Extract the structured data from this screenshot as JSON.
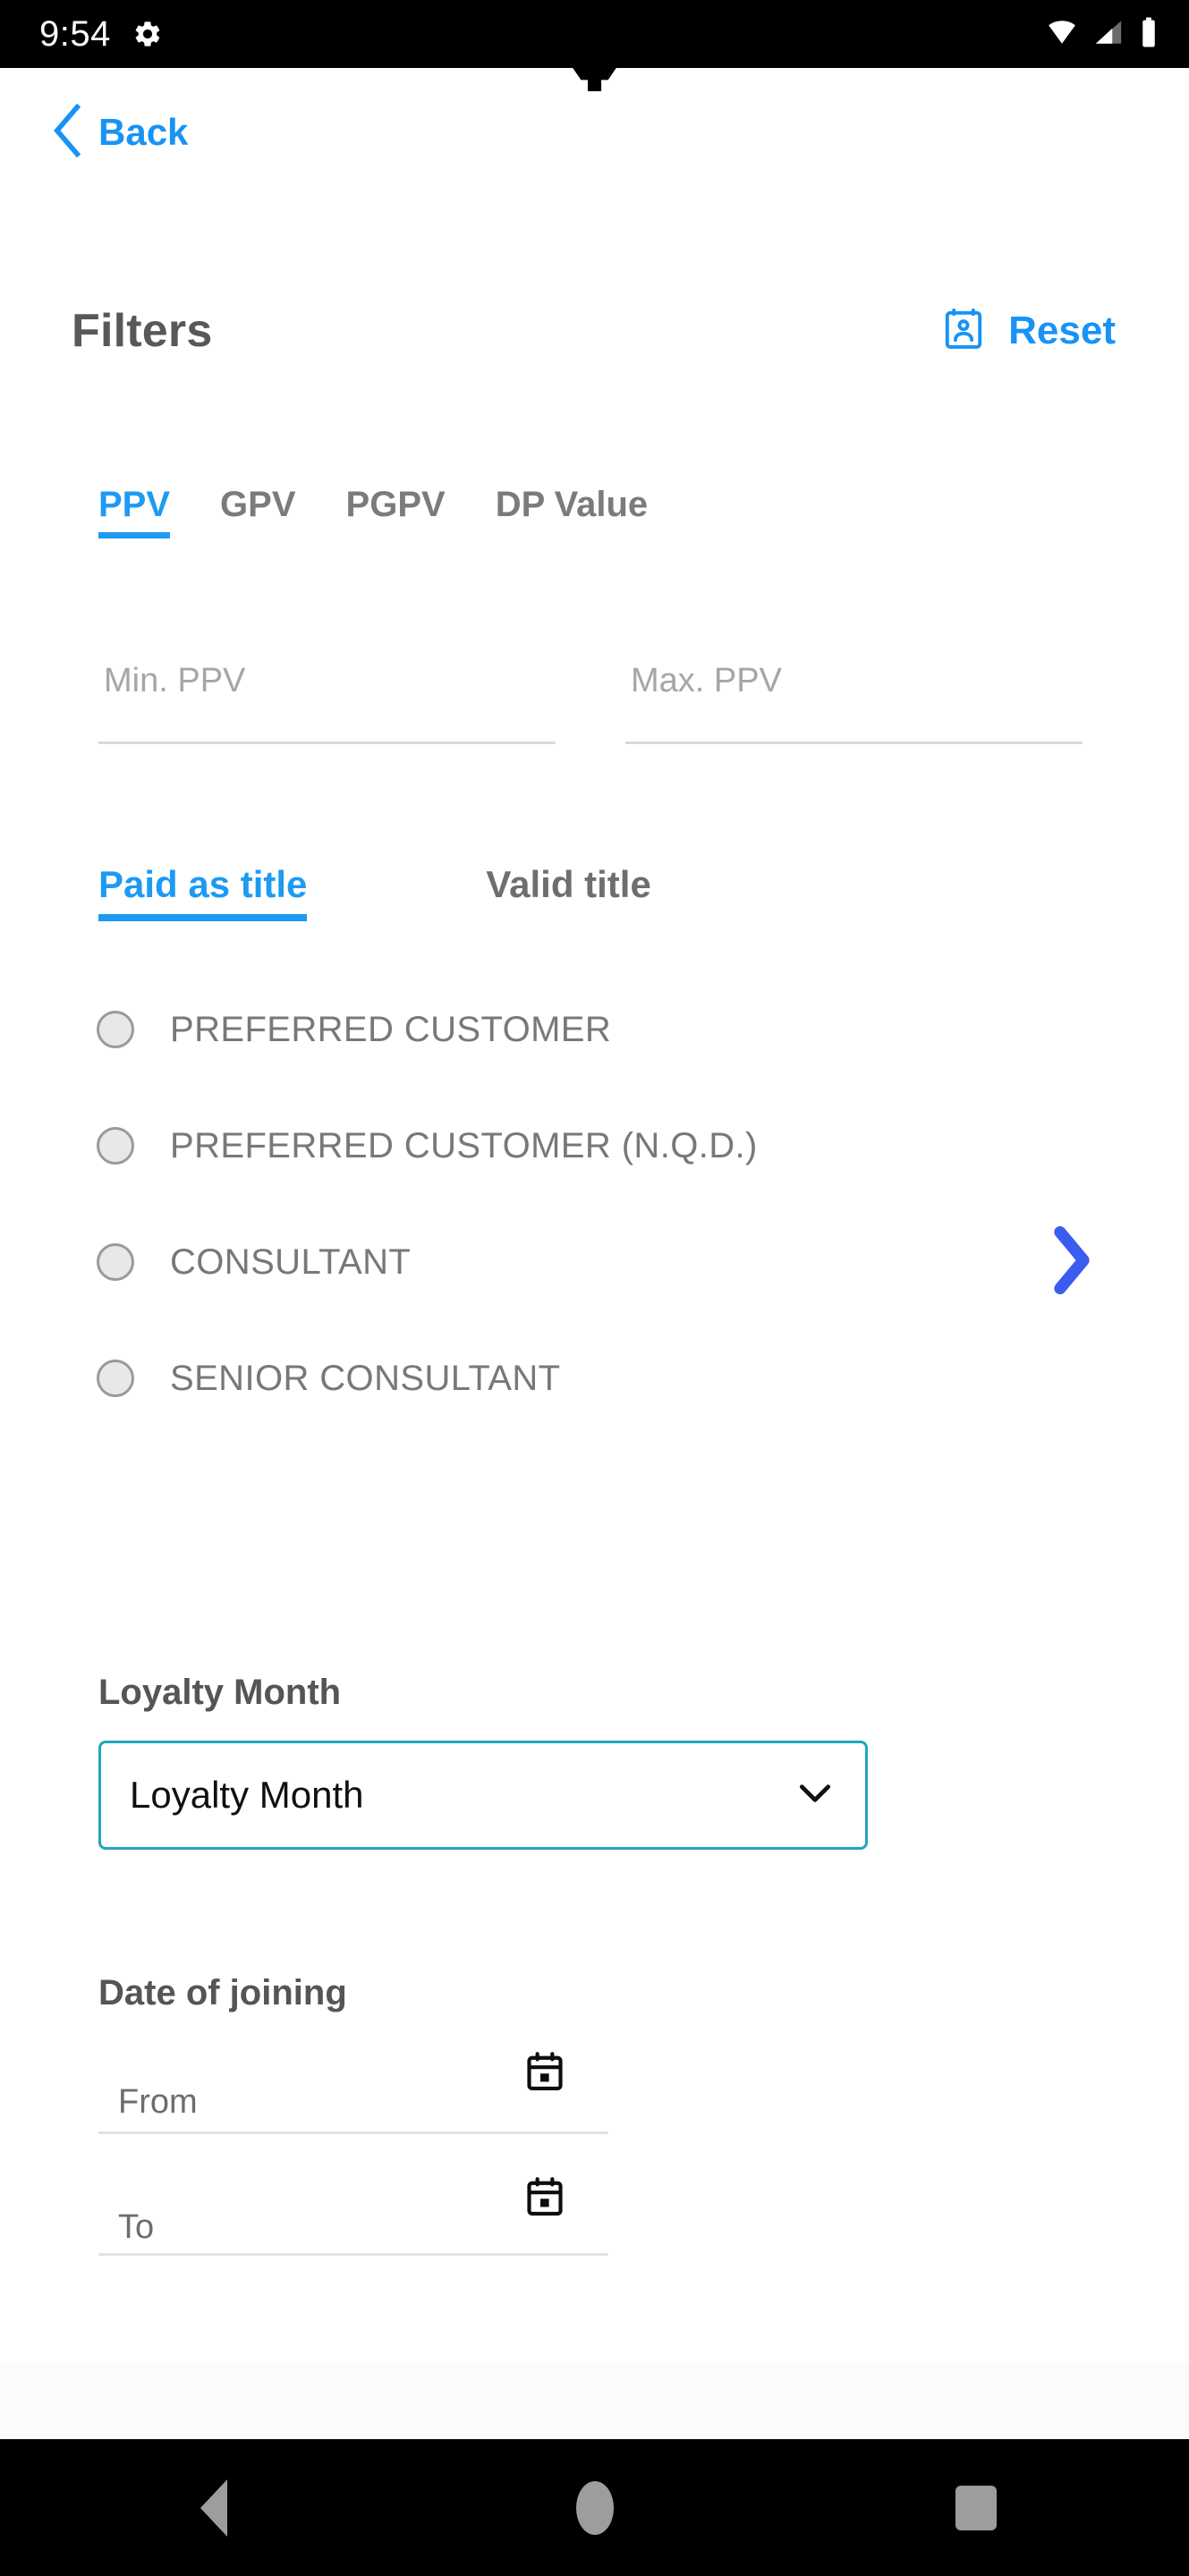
{
  "status_bar": {
    "time": "9:54",
    "icons": [
      "gear-icon",
      "wifi-icon",
      "cellular-signal-icon",
      "battery-icon"
    ]
  },
  "nav": {
    "back_label": "Back",
    "back_icon": "chevron-left-icon"
  },
  "header": {
    "title": "Filters",
    "reset_label": "Reset",
    "reset_icon": "contact-card-icon"
  },
  "value_tabs": {
    "active_index": 0,
    "items": [
      {
        "label": "PPV"
      },
      {
        "label": "GPV"
      },
      {
        "label": "PGPV"
      },
      {
        "label": "DP Value"
      }
    ]
  },
  "range_inputs": {
    "min": {
      "value": "",
      "placeholder": "Min. PPV"
    },
    "max": {
      "value": "",
      "placeholder": "Max. PPV"
    }
  },
  "title_tabs": {
    "active_index": 0,
    "items": [
      {
        "label": "Paid as title"
      },
      {
        "label": "Valid title"
      }
    ]
  },
  "title_options": [
    {
      "label": "PREFERRED CUSTOMER",
      "selected": false
    },
    {
      "label": "PREFERRED CUSTOMER (N.Q.D.)",
      "selected": false
    },
    {
      "label": "CONSULTANT",
      "selected": false
    },
    {
      "label": "SENIOR CONSULTANT",
      "selected": false
    }
  ],
  "next_arrow": {
    "icon": "chevron-right-icon"
  },
  "loyalty": {
    "section_label": "Loyalty Month",
    "select_value": "Loyalty Month",
    "chevron_icon": "chevron-down-icon"
  },
  "date_of_joining": {
    "section_label": "Date of joining",
    "from": {
      "value": "",
      "placeholder": "From",
      "icon": "calendar-icon"
    },
    "to": {
      "value": "",
      "placeholder": "To",
      "icon": "calendar-icon"
    }
  },
  "system_nav": {
    "back": "back-triangle-icon",
    "home": "home-circle-icon",
    "recents": "recents-square-icon"
  },
  "colors": {
    "accent_blue": "#1893f5",
    "tab_blue": "#1e9af2",
    "arrow_indigo": "#3b5cf0",
    "select_border_teal": "#22a5bd",
    "text_gray": "#787878"
  }
}
